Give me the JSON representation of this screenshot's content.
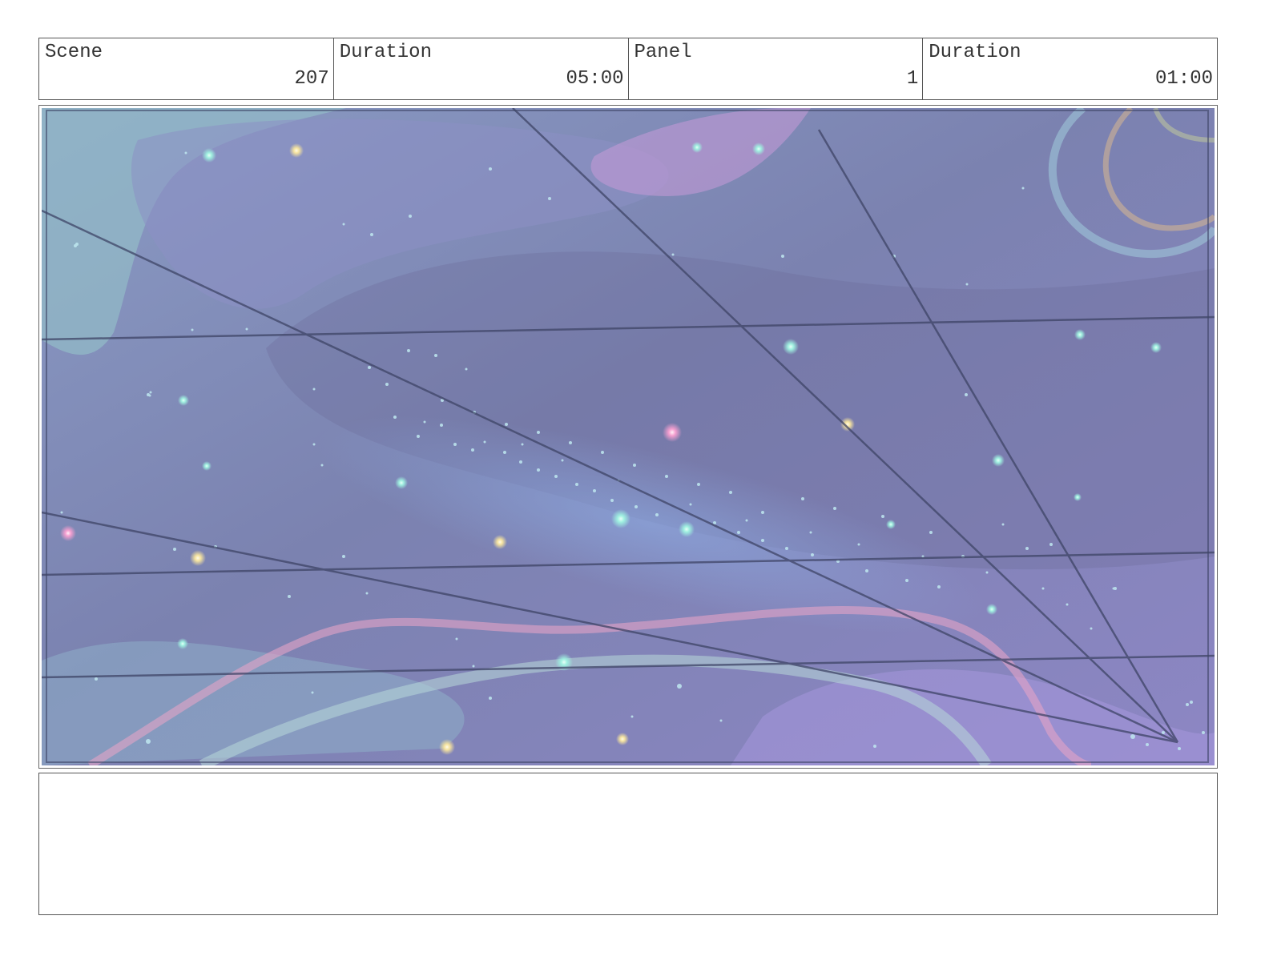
{
  "header": {
    "scene_label": "Scene",
    "scene_value": "207",
    "scene_duration_label": "Duration",
    "scene_duration_value": "05:00",
    "panel_label": "Panel",
    "panel_value": "1",
    "panel_duration_label": "Duration",
    "panel_duration_value": "01:00"
  },
  "artwork": {
    "subject": "starry galaxy sky with perspective guide lines",
    "colors": {
      "base": "#7a86b8",
      "purple": "#9d8bc8",
      "teal": "#8fb8c8",
      "pink": "#d89bd0",
      "guide_line": "#3e4466"
    }
  },
  "notes": {
    "text": ""
  }
}
